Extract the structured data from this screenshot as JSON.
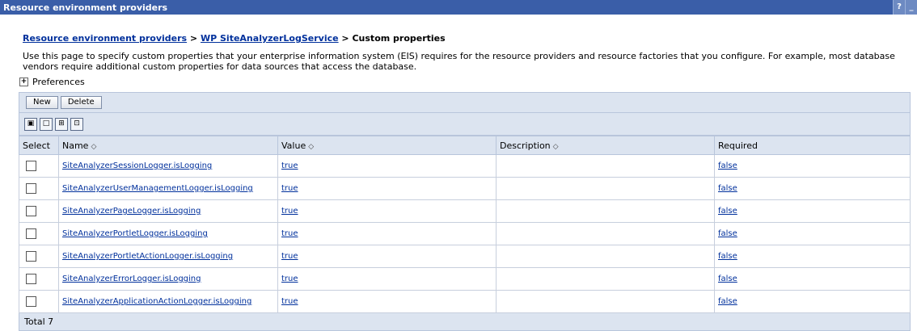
{
  "window": {
    "title": "Resource environment providers",
    "help_label": "?",
    "minimize_label": "_"
  },
  "breadcrumb": {
    "items": [
      "Resource environment providers",
      "WP SiteAnalyzerLogService"
    ],
    "separator": " > ",
    "current": "Custom properties"
  },
  "description": "Use this page to specify custom properties that your enterprise information system (EIS) requires for the resource providers and resource factories that you configure. For example, most database vendors require additional custom properties for data sources that access the database.",
  "preferences": {
    "toggle": "+",
    "label": "Preferences"
  },
  "toolbar": {
    "new_label": "New",
    "delete_label": "Delete"
  },
  "icons": [
    "select-all-icon",
    "deselect-all-icon",
    "show-filter-icon",
    "clear-filter-icon"
  ],
  "table": {
    "headers": [
      "Select",
      "Name",
      "Value",
      "Description",
      "Required"
    ],
    "sort_glyph": "◇",
    "rows": [
      {
        "name": "SiteAnalyzerSessionLogger.isLogging",
        "value": "true",
        "description": "",
        "required": "false"
      },
      {
        "name": "SiteAnalyzerUserManagementLogger.isLogging",
        "value": "true",
        "description": "",
        "required": "false"
      },
      {
        "name": "SiteAnalyzerPageLogger.isLogging",
        "value": "true",
        "description": "",
        "required": "false"
      },
      {
        "name": "SiteAnalyzerPortletLogger.isLogging",
        "value": "true",
        "description": "",
        "required": "false"
      },
      {
        "name": "SiteAnalyzerPortletActionLogger.isLogging",
        "value": "true",
        "description": "",
        "required": "false"
      },
      {
        "name": "SiteAnalyzerErrorLogger.isLogging",
        "value": "true",
        "description": "",
        "required": "false"
      },
      {
        "name": "SiteAnalyzerApplicationActionLogger.isLogging",
        "value": "true",
        "description": "",
        "required": "false"
      }
    ],
    "total": "Total 7"
  },
  "colors": {
    "titlebar": "#3a5ea8",
    "link": "#00309c",
    "panel": "#dce4f0"
  }
}
